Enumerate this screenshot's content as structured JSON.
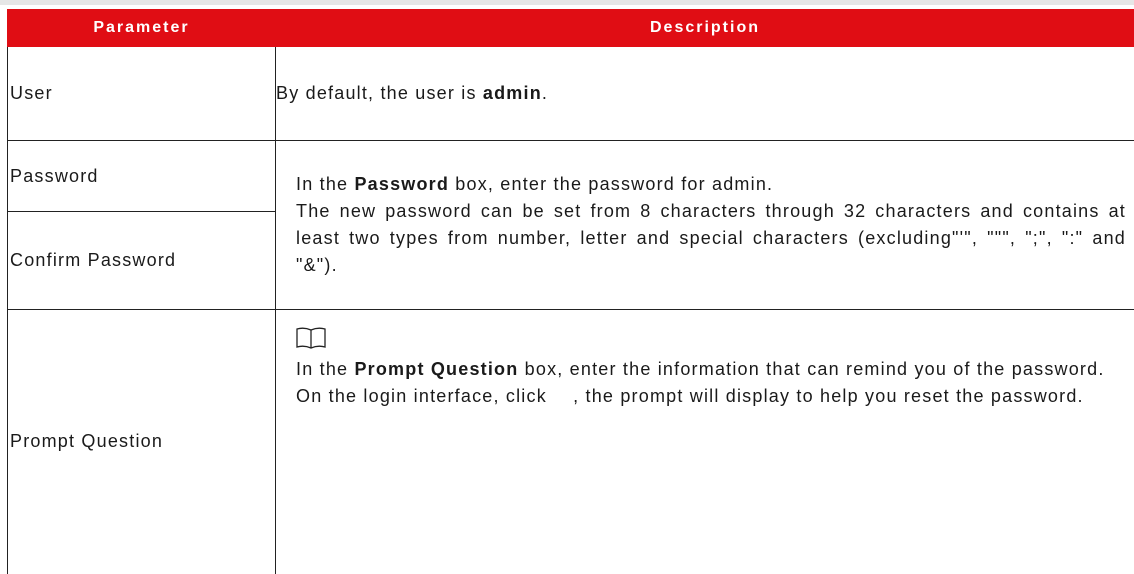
{
  "table": {
    "headers": [
      "Parameter",
      "Description"
    ],
    "user": {
      "param": "User",
      "desc_pre": "By default, the user is ",
      "desc_bold": "admin",
      "desc_post": "."
    },
    "password": {
      "param": "Password",
      "confirm_param": "Confirm Password",
      "line1_pre": "In the ",
      "line1_bold": "Password",
      "line1_post": " box, enter the password for admin.",
      "line2": "The new password can be set from 8 characters through 32 characters and contains at least two types from number, letter and special characters (excluding\"'\", \"\"\", \";\", \":\" and \"&\")."
    },
    "prompt": {
      "param": "Prompt Question",
      "note_icon": "book-note-icon",
      "line1_pre": "In the ",
      "line1_bold": "Prompt Question",
      "line1_post": " box, enter the information that can remind you of the password.",
      "line2_pre": "On the login interface, click ",
      "line2_post": ", the prompt will display to help you reset the password."
    }
  },
  "colors": {
    "header_bg": "#e00d14",
    "header_text": "#ffffff",
    "border": "#222222"
  }
}
